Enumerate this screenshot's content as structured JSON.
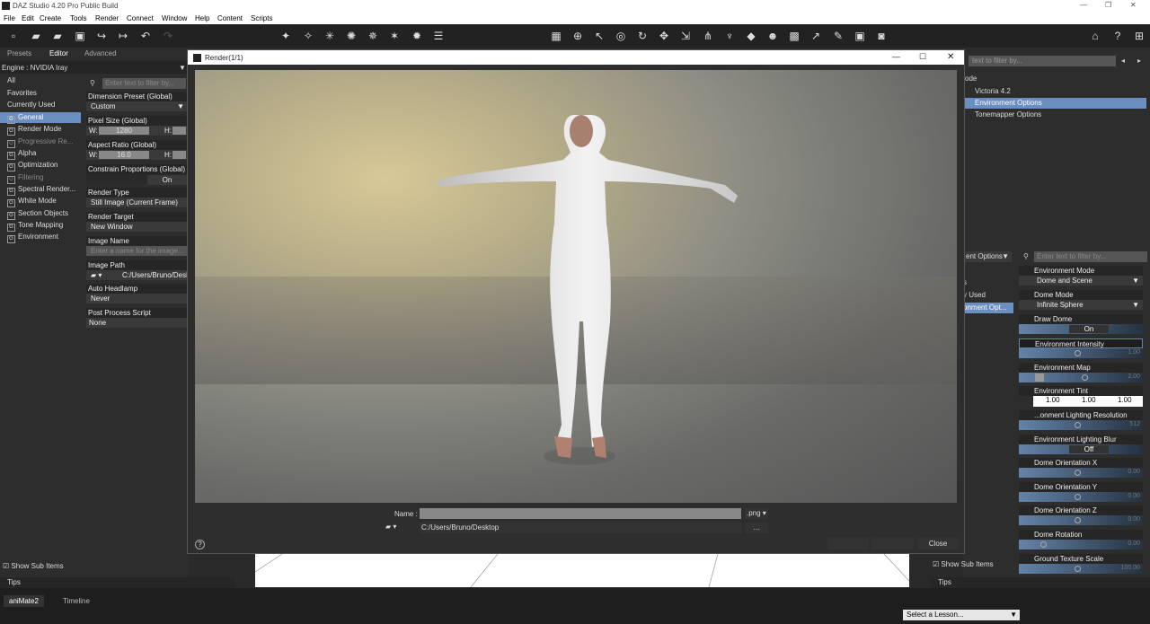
{
  "app": {
    "title": "DAZ Studio 4.20 Pro Public Build"
  },
  "menu": [
    "File",
    "Edit",
    "Create",
    "Tools",
    "Render",
    "Connect",
    "Window",
    "Help",
    "Content",
    "Scripts"
  ],
  "left": {
    "tabs": [
      "Presets",
      "Editor",
      "Advanced"
    ],
    "engine": "Engine : NVIDIA Iray",
    "filter_placeholder": "Enter text to filter by...",
    "categories": [
      "All",
      "Favorites",
      "Currently Used",
      "General",
      "Render Mode",
      "Progressive Re...",
      "Alpha",
      "Optimization",
      "Filtering",
      "Spectral Render...",
      "White Mode",
      "Section Objects",
      "Tone Mapping",
      "Environment"
    ],
    "props": {
      "dim_preset_label": "Dimension Preset (Global)",
      "dim_preset_val": "Custom",
      "pixel_size_label": "Pixel Size (Global)",
      "w_label": "W:",
      "w_val": "1280",
      "h_label": "H:",
      "aspect_label": "Aspect Ratio (Global)",
      "aspect_w": "16.0",
      "constrain_label": "Constrain Proportions (Global)",
      "constrain_val": "On",
      "render_type_label": "Render Type",
      "render_type_val": "Still Image (Current Frame)",
      "render_target_label": "Render Target",
      "render_target_val": "New Window",
      "image_name_label": "Image Name",
      "image_name_placeholder": "Enter a name for the image...",
      "image_path_label": "Image Path",
      "image_path_val": "C:/Users/Bruno/Desk",
      "headlamp_label": "Auto Headlamp",
      "headlamp_val": "Never",
      "pps_label": "Post Process Script",
      "pps_val": "None"
    },
    "show_sub": "Show Sub Items",
    "tips": "Tips"
  },
  "render_window": {
    "title": "Render(1/1)",
    "name_label": "Name :",
    "ext": ".png",
    "path": "C:/Users/Bruno/Desktop",
    "browse": "...",
    "close": "Close"
  },
  "right": {
    "filter_placeholder": "text to filter by...",
    "mode_label": "ode",
    "items": [
      "Victoria 4.2",
      "Environment Options",
      "Tonemapper Options"
    ],
    "dropdown": "ent Options",
    "side_items": [
      "s",
      "y Used",
      "onment Opt..."
    ],
    "filter2_placeholder": "Enter text to filter by...",
    "props": {
      "env_mode_label": "Environment Mode",
      "env_mode_val": "Dome and Scene",
      "dome_mode_label": "Dome Mode",
      "dome_mode_val": "Infinite Sphere",
      "draw_dome_label": "Draw Dome",
      "draw_dome_val": "On",
      "env_int_label": "Environment Intensity",
      "env_int_val": "1.00",
      "env_map_label": "Environment Map",
      "env_map_val": "2.00",
      "env_tint_label": "Environment Tint",
      "tint_r": "1.00",
      "tint_g": "1.00",
      "tint_b": "1.00",
      "env_light_res_label": "...onment Lighting Resolution",
      "env_light_res_val": "512",
      "env_blur_label": "Environment Lighting Blur",
      "env_blur_val": "Off",
      "dome_x_label": "Dome Orientation X",
      "dome_x_val": "0.00",
      "dome_y_label": "Dome Orientation Y",
      "dome_y_val": "0.00",
      "dome_z_label": "Dome Orientation Z",
      "dome_z_val": "0.00",
      "dome_rot_label": "Dome Rotation",
      "dome_rot_val": "0.00",
      "ground_label": "Ground Texture Scale",
      "ground_val": "100.00"
    },
    "show_sub": "Show Sub Items",
    "tips": "Tips"
  },
  "bottom": {
    "tabs": [
      "aniMate2",
      "Timeline"
    ],
    "lesson": "Select a Lesson..."
  }
}
